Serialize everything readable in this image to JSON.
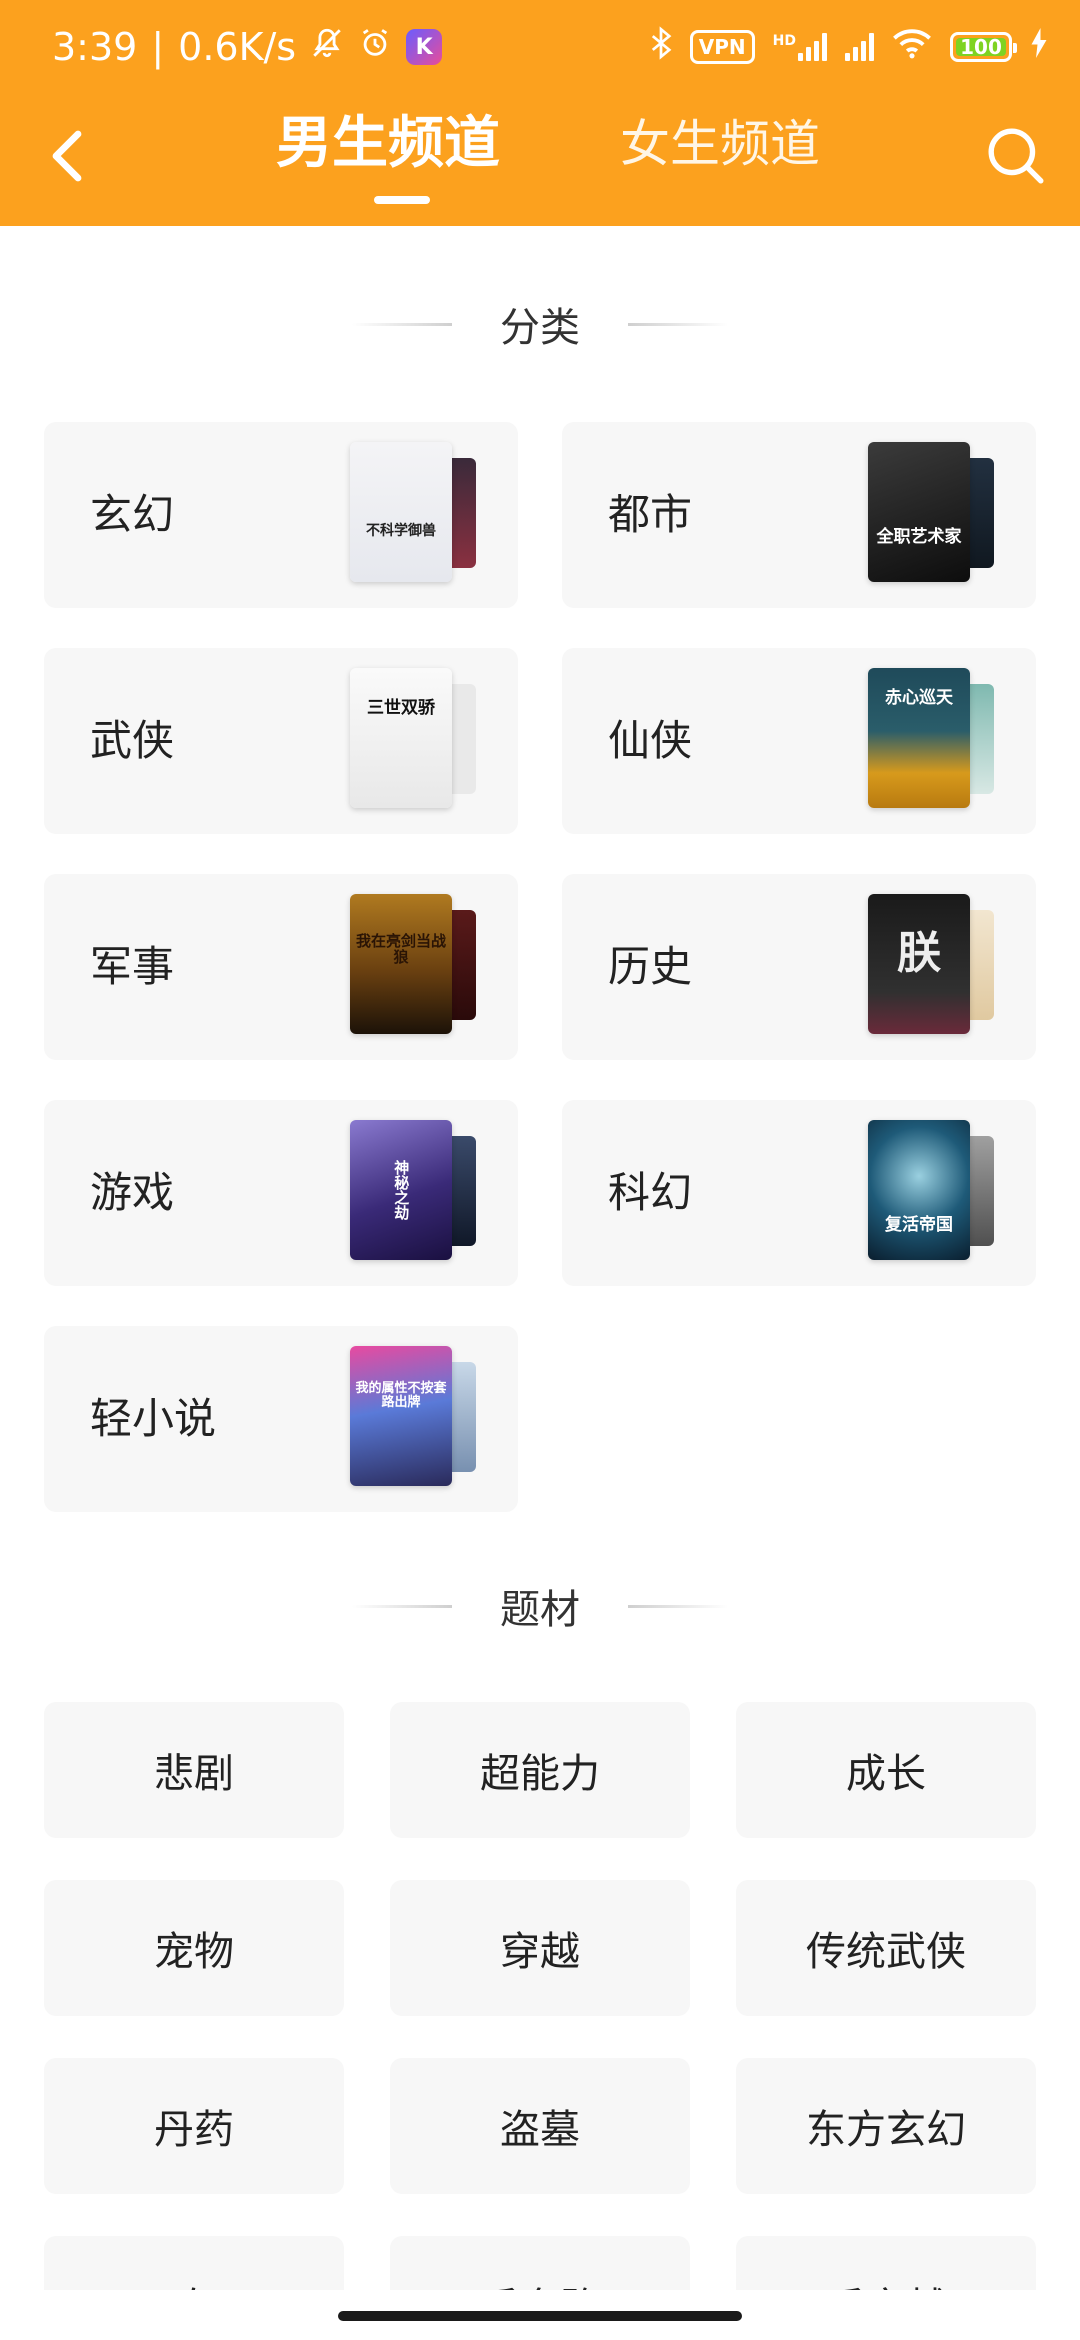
{
  "status_bar": {
    "time": "3:39",
    "separator": "|",
    "net_speed": "0.6K/s",
    "vpn": "VPN",
    "hd": "HD",
    "battery": "100"
  },
  "nav": {
    "tabs": [
      {
        "label": "男生频道",
        "active": true
      },
      {
        "label": "女生频道",
        "active": false
      }
    ],
    "back_icon": "chevron-left-icon",
    "search_icon": "search-icon"
  },
  "colors": {
    "header": "#FCA11E",
    "card_bg": "#F7F7F7"
  },
  "sections": {
    "category_title": "分类",
    "theme_title": "题材"
  },
  "categories": [
    {
      "label": "玄幻",
      "cover_title": "不科学御兽"
    },
    {
      "label": "都市",
      "cover_title": "全职艺术家"
    },
    {
      "label": "武侠",
      "cover_title": "三世双骄"
    },
    {
      "label": "仙侠",
      "cover_title": "赤心巡天"
    },
    {
      "label": "军事",
      "cover_title": "我在亮剑当战狼"
    },
    {
      "label": "历史",
      "cover_title": "朕"
    },
    {
      "label": "游戏",
      "cover_title": "神秘之劫"
    },
    {
      "label": "科幻",
      "cover_title": "复活帝国"
    },
    {
      "label": "轻小说",
      "cover_title": "我的属性不按套路出牌"
    }
  ],
  "themes": [
    "悲剧",
    "超能力",
    "成长",
    "宠物",
    "穿越",
    "传统武侠",
    "丹药",
    "盗墓",
    "东方玄幻",
    "二次元",
    "反套路",
    "反穿越"
  ]
}
